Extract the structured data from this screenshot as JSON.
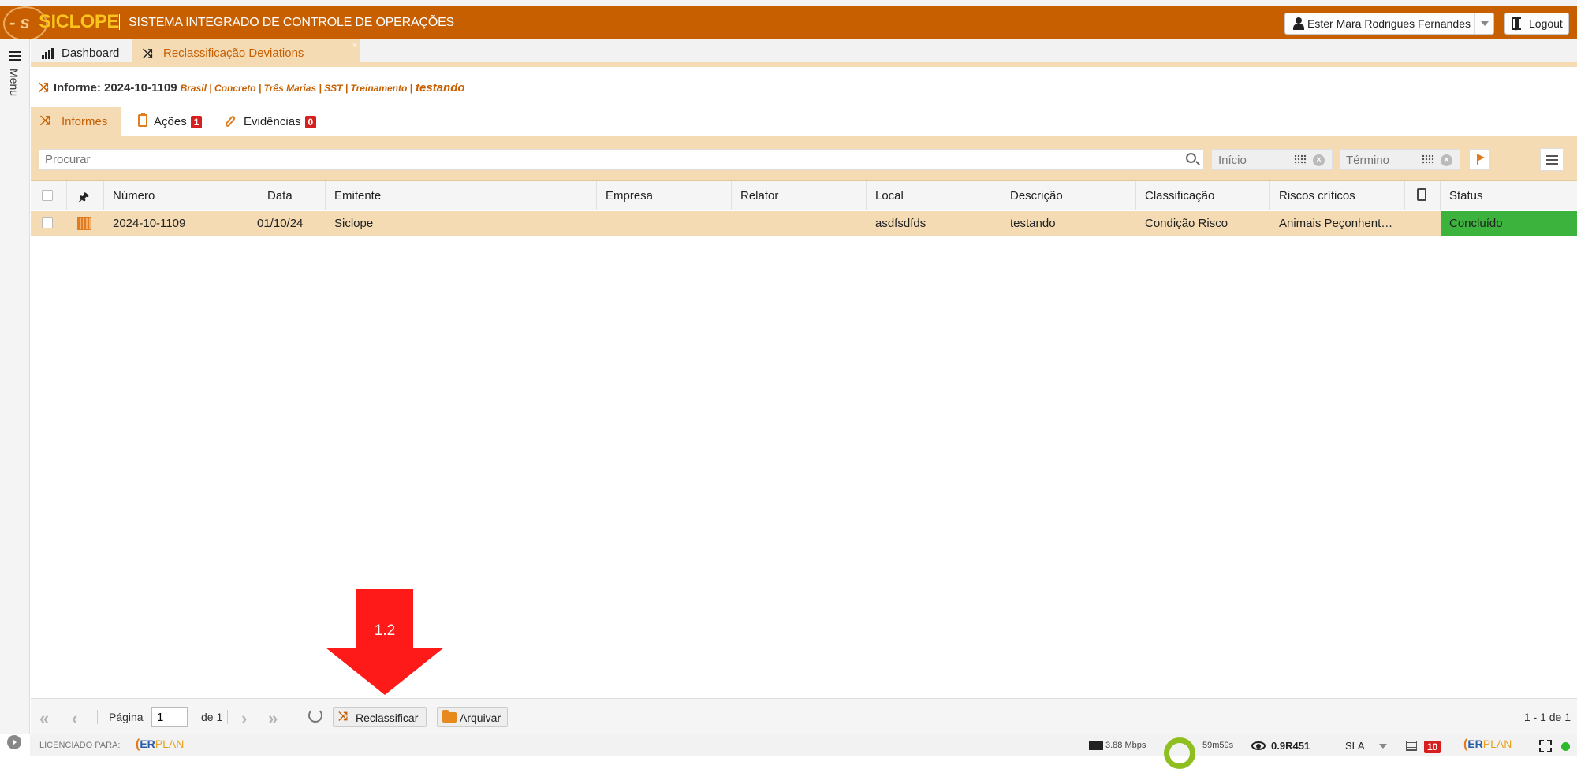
{
  "header": {
    "logo": "SICLOPE",
    "system_title": "SISTEMA INTEGRADO DE CONTROLE DE OPERAÇÕES",
    "user_name": "Ester Mara Rodrigues Fernandes",
    "logout_label": "Logout"
  },
  "menu": {
    "label": "Menu"
  },
  "app_tabs": [
    {
      "label": "Dashboard",
      "icon": "bar-chart-icon"
    },
    {
      "label": "Reclassificação Deviations",
      "icon": "shuffle-icon",
      "active": true,
      "close": "×"
    }
  ],
  "informe": {
    "label": "Informe: 2024-10-1109",
    "tags": "Brasil | Concreto | Três Marias | SST | Treinamento |",
    "description": "testando"
  },
  "sub_tabs": [
    {
      "label": "Informes",
      "active": true
    },
    {
      "label": "Ações",
      "badge": "1"
    },
    {
      "label": "Evidências",
      "badge": "0"
    }
  ],
  "filters": {
    "search_placeholder": "Procurar",
    "start_placeholder": "Início",
    "end_placeholder": "Término"
  },
  "table": {
    "columns": [
      "",
      "",
      "Número",
      "Data",
      "Emitente",
      "Empresa",
      "Relator",
      "Local",
      "Descrição",
      "Classificação",
      "Riscos críticos",
      "",
      "Status"
    ],
    "rows": [
      {
        "numero": "2024-10-1109",
        "data": "01/10/24",
        "emitente": "Siclope",
        "empresa": "",
        "relator": "",
        "local": "asdfsdfds",
        "descricao": "testando",
        "classificacao": "Condição Risco",
        "riscos": "Animais Peçonhent…",
        "status": "Concluído",
        "status_color": "#3cb33c"
      }
    ]
  },
  "pager": {
    "page_label": "Página",
    "page_value": "1",
    "of_label": "de 1",
    "reclassify_label": "Reclassificar",
    "archive_label": "Arquivar",
    "count": "1 - 1 de 1"
  },
  "status_bar": {
    "license_label": "LICENCIADO PARA:",
    "brand_er": "ER",
    "brand_plan": "PLAN",
    "net_speed": "3.88 Mbps",
    "timer": "59m59s",
    "version": "0.9R451",
    "sla_label": "SLA",
    "notifications": "10"
  },
  "annotation": {
    "label": "1.2",
    "color": "#ff1a1a"
  },
  "colors": {
    "brand": "#c75f00",
    "tab_bg": "#f4dbb4",
    "accent": "#e07b20"
  }
}
